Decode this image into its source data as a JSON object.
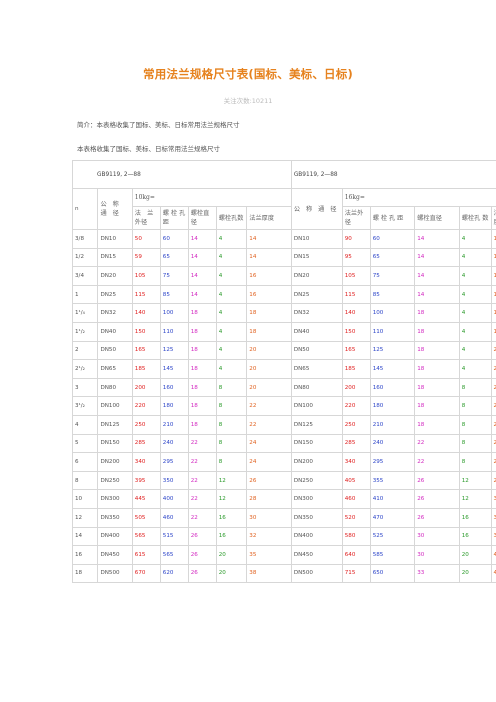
{
  "page": {
    "title": "常用法兰规格尺寸表(国标、美标、日标)",
    "views": "关注次数:10211",
    "intro1": "简介：本表格收集了国标、美标、日标常用法兰规格尺寸",
    "intro2": "本表格收集了国标、美标、日标常用法兰规格尺寸"
  },
  "table": {
    "std_left": "GB9119, 2—88",
    "std_right": "GB9119, 2—88",
    "pressure_left": "10kg=",
    "pressure_right": "16kg=",
    "n_label": "n",
    "nominal_label": "公 称 通 径",
    "nominal_label_right": "公 称 通 径",
    "headers_left": [
      "法　兰 外径",
      "螺 栓 孔 距",
      "螺栓直 径",
      "螺栓孔数",
      "法兰厚度"
    ],
    "headers_right": [
      "法兰外 径",
      "螺 栓 孔 距",
      "螺栓直径",
      "螺栓孔 数",
      "法 兰 度"
    ],
    "rows": [
      {
        "size": "3/8",
        "dn": "DN10",
        "l": [
          "50",
          "60",
          "14",
          "4",
          "14"
        ],
        "r": [
          "90",
          "60",
          "14",
          "4",
          "14"
        ]
      },
      {
        "size": "1/2",
        "dn": "DN15",
        "l": [
          "59",
          "65",
          "14",
          "4",
          "14"
        ],
        "r": [
          "95",
          "65",
          "14",
          "4",
          "14"
        ]
      },
      {
        "size": "3/4",
        "dn": "DN20",
        "l": [
          "105",
          "75",
          "14",
          "4",
          "16"
        ],
        "r": [
          "105",
          "75",
          "14",
          "4",
          "16"
        ]
      },
      {
        "size": "1",
        "dn": "DN25",
        "l": [
          "115",
          "85",
          "14",
          "4",
          "16"
        ],
        "r": [
          "115",
          "85",
          "14",
          "4",
          "16"
        ]
      },
      {
        "size": "1¹/₄",
        "dn": "DN32",
        "l": [
          "140",
          "100",
          "18",
          "4",
          "18"
        ],
        "r": [
          "140",
          "100",
          "18",
          "4",
          "18"
        ]
      },
      {
        "size": "1¹/₂",
        "dn": "DN40",
        "l": [
          "150",
          "110",
          "18",
          "4",
          "18"
        ],
        "r": [
          "150",
          "110",
          "18",
          "4",
          "18"
        ]
      },
      {
        "size": "2",
        "dn": "DN50",
        "l": [
          "165",
          "125",
          "18",
          "4",
          "20"
        ],
        "r": [
          "165",
          "125",
          "18",
          "4",
          "20"
        ]
      },
      {
        "size": "2¹/₂",
        "dn": "DN65",
        "l": [
          "185",
          "145",
          "18",
          "4",
          "20"
        ],
        "r": [
          "185",
          "145",
          "18",
          "4",
          "20"
        ]
      },
      {
        "size": "3",
        "dn": "DN80",
        "l": [
          "200",
          "160",
          "18",
          "8",
          "20"
        ],
        "r": [
          "200",
          "160",
          "18",
          "8",
          "20"
        ]
      },
      {
        "size": "3¹/₂",
        "dn": "DN100",
        "l": [
          "220",
          "180",
          "18",
          "8",
          "22"
        ],
        "r": [
          "220",
          "180",
          "18",
          "8",
          "22"
        ]
      },
      {
        "size": "4",
        "dn": "DN125",
        "l": [
          "250",
          "210",
          "18",
          "8",
          "22"
        ],
        "r": [
          "250",
          "210",
          "18",
          "8",
          "22"
        ]
      },
      {
        "size": "5",
        "dn": "DN150",
        "l": [
          "285",
          "240",
          "22",
          "8",
          "24"
        ],
        "r": [
          "285",
          "240",
          "22",
          "8",
          "24"
        ]
      },
      {
        "size": "6",
        "dn": "DN200",
        "l": [
          "340",
          "295",
          "22",
          "8",
          "24"
        ],
        "r": [
          "340",
          "295",
          "22",
          "8",
          "26"
        ]
      },
      {
        "size": "8",
        "dn": "DN250",
        "l": [
          "395",
          "350",
          "22",
          "12",
          "26"
        ],
        "r": [
          "405",
          "355",
          "26",
          "12",
          "29"
        ]
      },
      {
        "size": "10",
        "dn": "DN300",
        "l": [
          "445",
          "400",
          "22",
          "12",
          "28"
        ],
        "r": [
          "460",
          "410",
          "26",
          "12",
          "32"
        ]
      },
      {
        "size": "12",
        "dn": "DN350",
        "l": [
          "505",
          "460",
          "22",
          "16",
          "30"
        ],
        "r": [
          "520",
          "470",
          "26",
          "16",
          "35"
        ]
      },
      {
        "size": "14",
        "dn": "DN400",
        "l": [
          "565",
          "515",
          "26",
          "16",
          "32"
        ],
        "r": [
          "580",
          "525",
          "30",
          "16",
          "38"
        ]
      },
      {
        "size": "16",
        "dn": "DN450",
        "l": [
          "615",
          "565",
          "26",
          "20",
          "35"
        ],
        "r": [
          "640",
          "585",
          "30",
          "20",
          "42"
        ]
      },
      {
        "size": "18",
        "dn": "DN500",
        "l": [
          "670",
          "620",
          "26",
          "20",
          "38"
        ],
        "r": [
          "715",
          "650",
          "33",
          "20",
          "46"
        ]
      }
    ],
    "colors": {
      "outer": "#e02020",
      "pcd": "#2d45c8",
      "bolt": "#d228c0",
      "holes": "#2a9a2a",
      "thick": "#e0601e"
    }
  }
}
